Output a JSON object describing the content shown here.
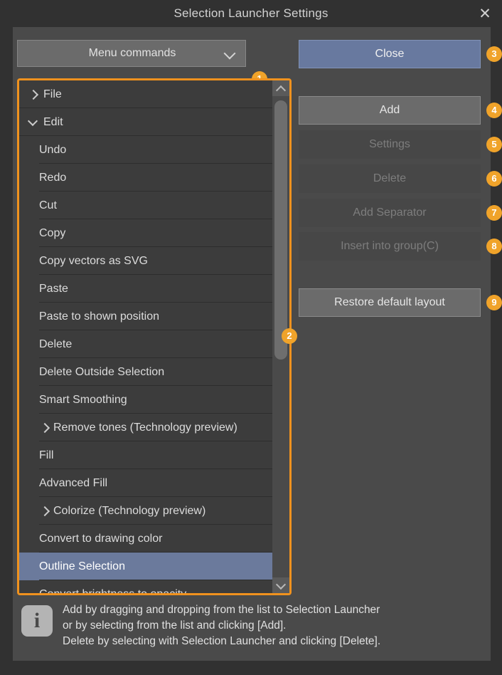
{
  "window": {
    "title": "Selection Launcher Settings",
    "close_icon": "close-icon"
  },
  "dropdown": {
    "value": "Menu commands",
    "chevron_icon": "chevron-down-icon"
  },
  "list": {
    "items": [
      {
        "label": "File",
        "level": 0,
        "chevron": "right",
        "selected": false
      },
      {
        "label": "Edit",
        "level": 0,
        "chevron": "down",
        "selected": false
      },
      {
        "label": "Undo",
        "level": 1,
        "chevron": "",
        "selected": false
      },
      {
        "label": "Redo",
        "level": 1,
        "chevron": "",
        "selected": false
      },
      {
        "label": "Cut",
        "level": 1,
        "chevron": "",
        "selected": false
      },
      {
        "label": "Copy",
        "level": 1,
        "chevron": "",
        "selected": false
      },
      {
        "label": "Copy vectors as SVG",
        "level": 1,
        "chevron": "",
        "selected": false
      },
      {
        "label": "Paste",
        "level": 1,
        "chevron": "",
        "selected": false
      },
      {
        "label": "Paste to shown position",
        "level": 1,
        "chevron": "",
        "selected": false
      },
      {
        "label": "Delete",
        "level": 1,
        "chevron": "",
        "selected": false
      },
      {
        "label": "Delete Outside Selection",
        "level": 1,
        "chevron": "",
        "selected": false
      },
      {
        "label": "Smart Smoothing",
        "level": 1,
        "chevron": "",
        "selected": false
      },
      {
        "label": "Remove tones (Technology preview)",
        "level": 1,
        "chevron": "right",
        "selected": false
      },
      {
        "label": "Fill",
        "level": 1,
        "chevron": "",
        "selected": false
      },
      {
        "label": "Advanced Fill",
        "level": 1,
        "chevron": "",
        "selected": false
      },
      {
        "label": "Colorize (Technology preview)",
        "level": 1,
        "chevron": "right",
        "selected": false
      },
      {
        "label": "Convert to drawing color",
        "level": 1,
        "chevron": "",
        "selected": false
      },
      {
        "label": "Outline Selection",
        "level": 1,
        "chevron": "",
        "selected": true
      },
      {
        "label": "Convert brightness to opacity",
        "level": 1,
        "chevron": "",
        "selected": false
      }
    ],
    "scrollbar": {
      "up_icon": "chevron-up-icon",
      "down_icon": "chevron-down-icon"
    }
  },
  "buttons": {
    "close": {
      "label": "Close",
      "state": "primary"
    },
    "add": {
      "label": "Add",
      "state": "normal"
    },
    "settings": {
      "label": "Settings",
      "state": "disabled"
    },
    "delete": {
      "label": "Delete",
      "state": "disabled"
    },
    "add_separator": {
      "label": "Add Separator",
      "state": "disabled"
    },
    "insert_into_group": {
      "label": "Insert into group(C)",
      "state": "disabled"
    },
    "restore_default_layout": {
      "label": "Restore default layout",
      "state": "normal"
    }
  },
  "badges": {
    "b1": "1",
    "b2": "2",
    "b3": "3",
    "b4": "4",
    "b5": "5",
    "b6": "6",
    "b7": "7",
    "b8": "8",
    "b9": "9"
  },
  "footer": {
    "icon": "info-icon",
    "line1": "Add by dragging and dropping from the list to Selection Launcher",
    "line2": " or by selecting from the list and clicking [Add].",
    "line3": "Delete by selecting with Selection Launcher and clicking [Delete]."
  },
  "colors": {
    "accent_orange": "#f0921e",
    "badge_orange": "#f0a32a",
    "primary_blue": "#68799f",
    "selection_blue": "#6b7a9c",
    "panel_bg": "#4a4a4a",
    "list_bg": "#3c3c3c",
    "titlebar_bg": "#313131"
  }
}
